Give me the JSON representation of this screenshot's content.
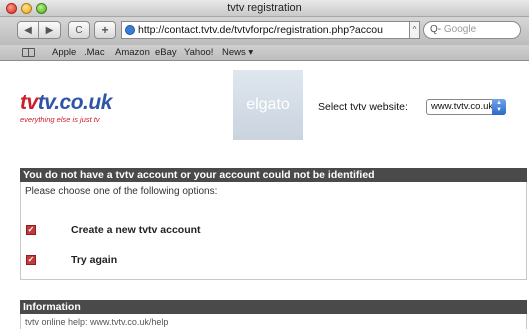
{
  "window": {
    "title": "tvtv registration"
  },
  "toolbar": {
    "back_icon": "◀",
    "forward_icon": "▶",
    "reload_icon": "C",
    "add_icon": "+",
    "url": "http://contact.tvtv.de/tvtvforpc/registration.php?accou",
    "search_placeholder": "Google",
    "search_prefix": "Q-"
  },
  "bookmarks": [
    "Apple",
    ".Mac",
    "Amazon",
    "eBay",
    "Yahoo!",
    "News ▾"
  ],
  "header": {
    "logo_text_red": "tv",
    "logo_text_blue": "tv",
    "logo_text_domain": ".co.uk",
    "tagline": "everything else is just tv",
    "elgato_text": "elgato",
    "select_label": "Select tvtv website:",
    "select_value": "www.tvtv.co.uk"
  },
  "account_section": {
    "title": "You do not have a tvtv account or your account could not be identified",
    "intro": "Please choose one of the following options:",
    "options": [
      {
        "label": "Create a new tvtv account"
      },
      {
        "label": "Try again"
      }
    ]
  },
  "info_section": {
    "title": "Information",
    "text": "tvtv online help: www.tvtv.co.uk/help"
  },
  "colors": {
    "accent_red": "#d01c2a",
    "logo_blue": "#2f55a8",
    "section_bar": "#4a4a4a",
    "checkbox": "#c23a3a"
  }
}
